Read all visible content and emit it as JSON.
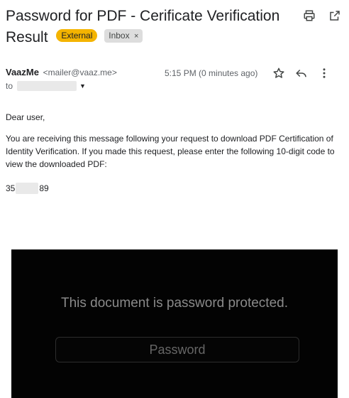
{
  "email": {
    "subject": "Password for PDF - Cerificate Verification Result",
    "labels": {
      "external": "External",
      "inbox": "Inbox",
      "inbox_remove": "×"
    },
    "sender": {
      "name": "VaazMe",
      "email": "<mailer@vaaz.me>"
    },
    "to_prefix": "to",
    "time": "5:15 PM (0 minutes ago)",
    "greeting": "Dear user,",
    "paragraph": "You are receiving this message following your request to download PDF Certification of Identity Verification. If you made this request, please enter the following 10-digit code to view the downloaded PDF:",
    "code_prefix": "35",
    "code_suffix": "89"
  },
  "pdf_prompt": {
    "message": "This document is password protected.",
    "password_placeholder": "Password"
  },
  "icons": [
    "print-icon",
    "open-in-new-window-icon",
    "star-icon",
    "reply-icon",
    "more-vert-icon",
    "dropdown-caret-icon"
  ],
  "colors": {
    "external_label": "#f4b400",
    "inbox_label": "#dddddd",
    "pdf_background": "#030303"
  }
}
